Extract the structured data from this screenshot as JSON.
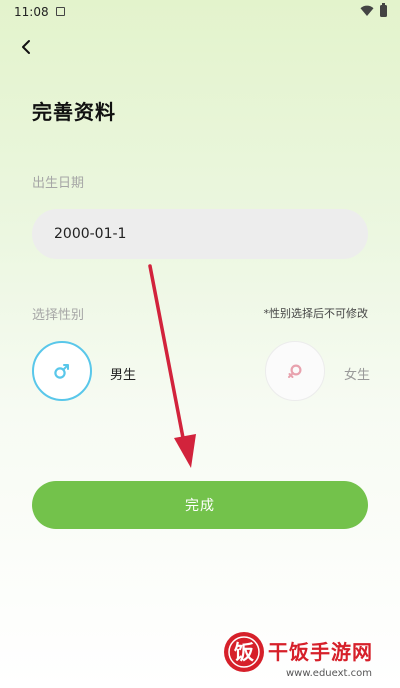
{
  "status_bar": {
    "time": "11:08"
  },
  "page": {
    "title": "完善资料"
  },
  "birth": {
    "label": "出生日期",
    "value": "2000-01-1"
  },
  "gender": {
    "label": "选择性别",
    "note": "*性别选择后不可修改",
    "options": [
      {
        "label": "男生",
        "selected": true
      },
      {
        "label": "女生",
        "selected": false
      }
    ]
  },
  "actions": {
    "done_label": "完成"
  },
  "watermark": {
    "brand": "干饭手游网",
    "url": "www.eduext.com",
    "seal_glyph": "饭"
  },
  "colors": {
    "accent_green": "#73c24b",
    "male_blue": "#59c7ea",
    "female_pink": "#e8a2ae",
    "annotation_arrow": "#d2233c",
    "watermark_red": "#d6202a"
  },
  "icons": [
    "back-arrow-icon",
    "sim-icon",
    "wifi-icon",
    "battery-icon",
    "male-symbol-icon",
    "female-symbol-icon"
  ]
}
